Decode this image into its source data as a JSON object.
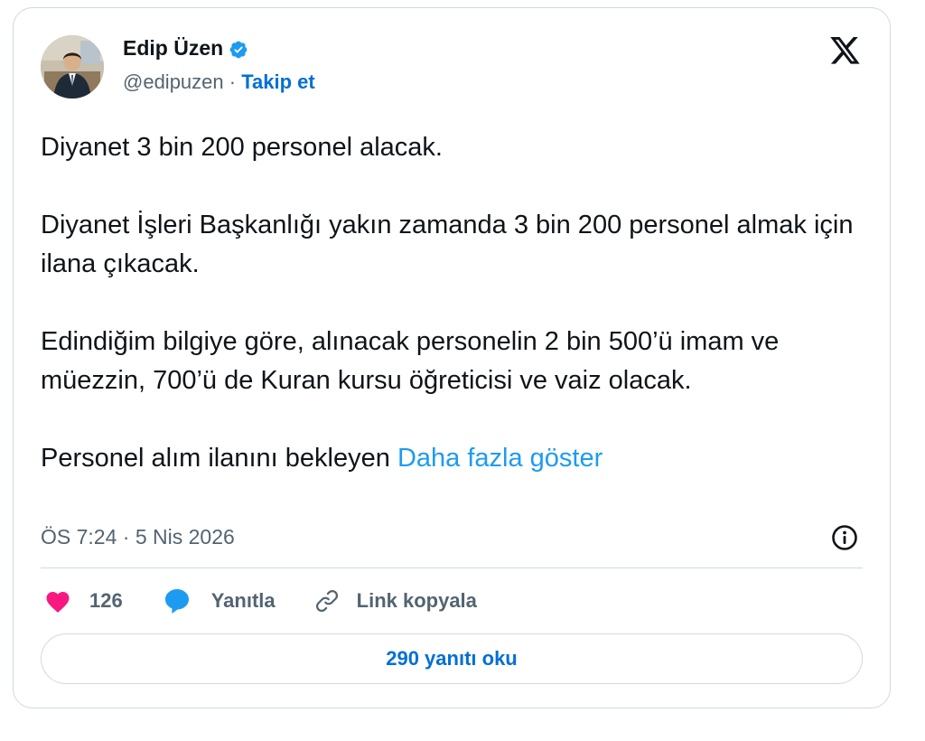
{
  "author": {
    "name": "Edip Üzen",
    "handle": "@edipuzen",
    "separator": "·",
    "follow_label": "Takip et"
  },
  "icons": {
    "verified": "verified-badge-icon",
    "brand": "x-logo-icon",
    "info": "info-icon",
    "like": "heart-icon",
    "reply": "speech-bubble-icon",
    "copy": "link-icon"
  },
  "tweet": {
    "paragraphs": [
      "Diyanet 3 bin 200 personel alacak.",
      "Diyanet İşleri Başkanlığı yakın zamanda 3 bin 200 personel almak için ilana çıkacak.",
      "Edindiğim bilgiye göre, alınacak personelin 2 bin 500’ü imam ve müezzin, 700’ü de Kuran kursu öğreticisi ve vaiz olacak."
    ],
    "last_line": "Personel alım ilanını bekleyen",
    "show_more": "Daha fazla göster"
  },
  "timestamp": "ÖS 7:24 · 5 Nis 2026",
  "actions": {
    "like_count": "126",
    "reply_label": "Yanıtla",
    "copy_label": "Link kopyala"
  },
  "read_replies_label": "290 yanıtı oku",
  "colors": {
    "accent": "#1d9bf0",
    "link_dark": "#006fd6",
    "like": "#f91880",
    "text": "#0f1419",
    "muted": "#536471",
    "border": "#cfd9de"
  }
}
